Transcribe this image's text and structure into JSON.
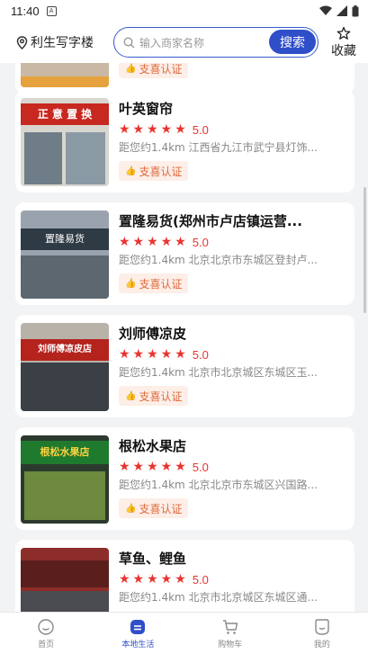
{
  "status_bar": {
    "time": "11:40"
  },
  "header": {
    "location": "利生写字楼",
    "search_placeholder": "输入商家名称",
    "search_button": "搜索",
    "favorite_label": "收藏"
  },
  "partial_top": {
    "badge": "支喜认证"
  },
  "shops": [
    {
      "name": "叶英窗帘",
      "stars": "★★★★★",
      "rating": "5.0",
      "address": "距您约1.4km  江西省九江市武宁县灯饰...",
      "badge": "支喜认证"
    },
    {
      "name": "置隆易货(郑州市卢店镇运营...",
      "stars": "★★★★★",
      "rating": "5.0",
      "address": "距您约1.4km  北京北京市东城区登封卢...",
      "badge": "支喜认证"
    },
    {
      "name": "刘师傅凉皮",
      "stars": "★★★★★",
      "rating": "5.0",
      "address": "距您约1.4km  北京市北京城区东城区玉...",
      "badge": "支喜认证"
    },
    {
      "name": "根松水果店",
      "stars": "★★★★★",
      "rating": "5.0",
      "address": "距您约1.4km  北京北京市东城区兴国路...",
      "badge": "支喜认证"
    },
    {
      "name": "草鱼、鲤鱼",
      "stars": "★★★★★",
      "rating": "5.0",
      "address": "距您约1.4km  北京市北京城区东城区通...",
      "badge": ""
    }
  ],
  "thumb_signs": [
    "正 意 置 换",
    "置隆易货",
    "刘师傅凉皮店",
    "根松水果店"
  ],
  "tabbar": {
    "items": [
      {
        "label": "首页",
        "icon": "home-icon"
      },
      {
        "label": "本地生活",
        "icon": "local-life-icon"
      },
      {
        "label": "购物车",
        "icon": "cart-icon"
      },
      {
        "label": "我的",
        "icon": "profile-icon"
      }
    ],
    "active_index": 1
  },
  "colors": {
    "accent": "#2f4fc9",
    "star": "#e8352f",
    "badge_text": "#e06a3a",
    "badge_bg": "#fdeee8"
  }
}
